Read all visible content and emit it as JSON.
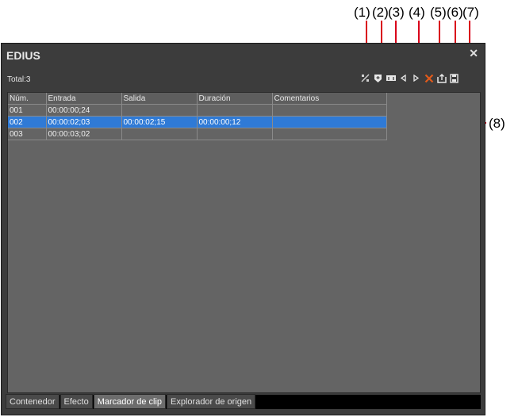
{
  "window": {
    "title": "EDIUS",
    "close_glyph": "✕"
  },
  "list": {
    "total_label": "Total:3",
    "columns": [
      "Núm.",
      "Entrada",
      "Salida",
      "Duración",
      "Comentarios"
    ],
    "rows": [
      [
        "001",
        "00:00:00;24",
        "",
        "",
        ""
      ],
      [
        "002",
        "00:00:02;03",
        "00:00:02;15",
        "00:00:00;12",
        ""
      ],
      [
        "003",
        "00:00:03;02",
        "",
        "",
        ""
      ]
    ],
    "selected_row": 1
  },
  "toolbar": {
    "icons": [
      "marker-in-out-icon",
      "add-marker-icon",
      "range-marker-icon",
      "prev-marker-icon",
      "next-marker-icon",
      "delete-marker-icon",
      "import-icon",
      "save-icon"
    ]
  },
  "tabs": [
    "Contenedor",
    "Efecto",
    "Marcador de clip",
    "Explorador de origen"
  ],
  "active_tab": 2,
  "callouts": [
    "(1)",
    "(2)",
    "(3)",
    "(4)",
    "(5)",
    "(6)",
    "(7)",
    "(8)"
  ],
  "colors": {
    "accent": "#d9001a",
    "selection": "#2f7ad6",
    "delete": "#e05a1a"
  }
}
